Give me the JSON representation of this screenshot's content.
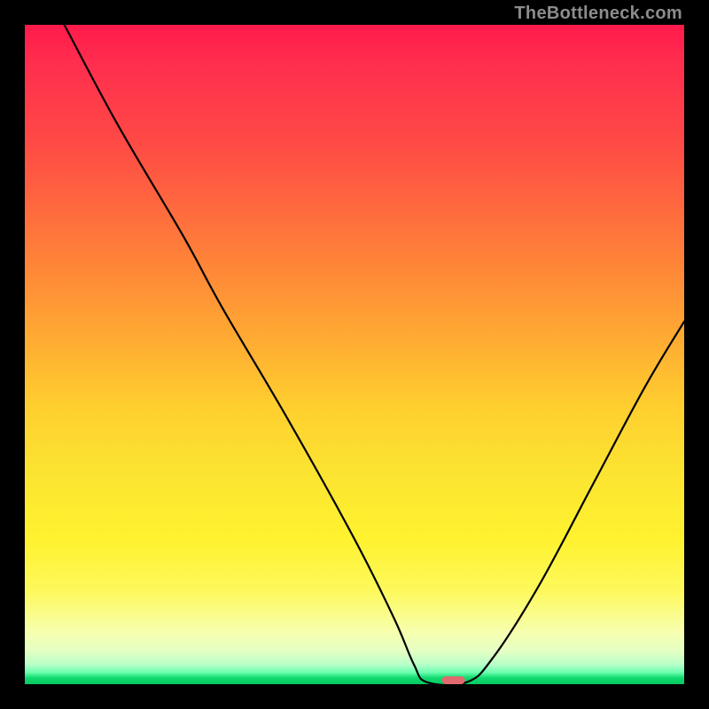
{
  "attribution": "TheBottleneck.com",
  "chart_data": {
    "type": "line",
    "title": "",
    "xlabel": "",
    "ylabel": "",
    "xlim": [
      0,
      100
    ],
    "ylim": [
      0,
      100
    ],
    "gradient_top_color": "#ff1a4b",
    "gradient_bottom_color": "#08c963",
    "curve_note": "Black V-shaped curve descending from top-left to a flat minimum near x≈64 then rising to the right.",
    "curve_points": [
      {
        "x": 6,
        "y": 100
      },
      {
        "x": 14,
        "y": 85
      },
      {
        "x": 24,
        "y": 68
      },
      {
        "x": 30,
        "y": 57
      },
      {
        "x": 40,
        "y": 40
      },
      {
        "x": 50,
        "y": 22
      },
      {
        "x": 56,
        "y": 10
      },
      {
        "x": 59,
        "y": 3
      },
      {
        "x": 61,
        "y": 0.3
      },
      {
        "x": 67,
        "y": 0.3
      },
      {
        "x": 71,
        "y": 4
      },
      {
        "x": 78,
        "y": 15
      },
      {
        "x": 86,
        "y": 30
      },
      {
        "x": 94,
        "y": 45
      },
      {
        "x": 100,
        "y": 55
      }
    ],
    "marker": {
      "x": 65,
      "y": 0.6,
      "width": 3.5,
      "height": 1.2,
      "color": "#e26a6f"
    }
  }
}
